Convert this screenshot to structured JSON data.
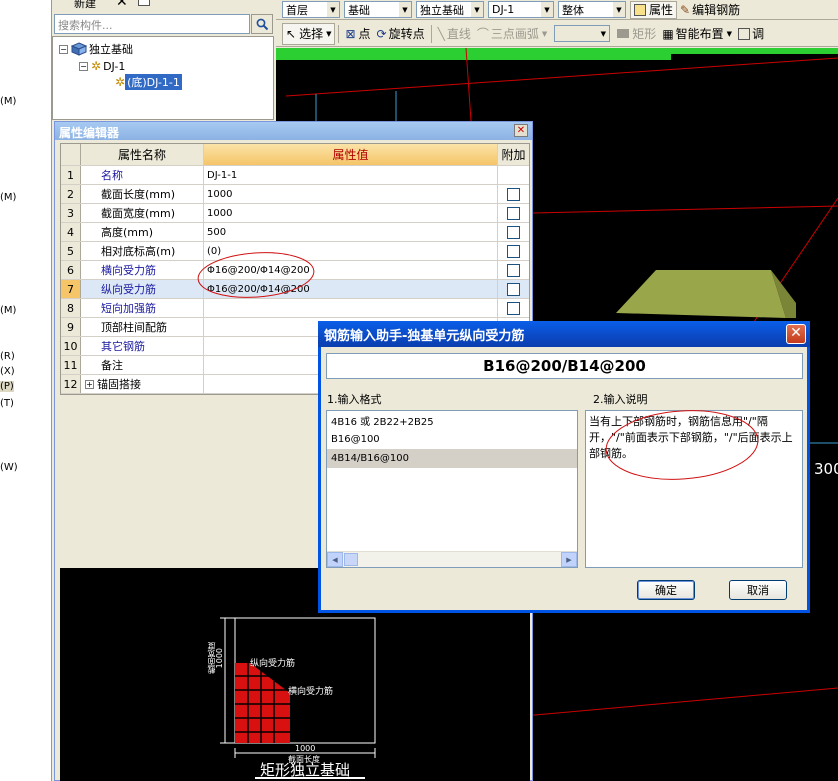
{
  "left_strip": {
    "hotkeys": [
      "(M)",
      "(M)",
      "(M)",
      "(R)",
      "(X)",
      "(P)",
      "(T)",
      "(W)"
    ]
  },
  "top_left_toolbar": {
    "new_label": "新建",
    "delete_icon": "delete-x-icon",
    "copy_icon": "copy-icon"
  },
  "search": {
    "placeholder": "搜索构件..."
  },
  "tree": {
    "root": "独立基础",
    "child": "DJ-1",
    "leaf": "(底)DJ-1-1"
  },
  "top_bar": {
    "combos": [
      "首层",
      "基础",
      "独立基础",
      "DJ-1",
      "整体"
    ],
    "property_label": "属性",
    "edit_rebar_label": "编辑钢筋"
  },
  "toolbar2": {
    "select": "选择",
    "point": "点",
    "rotate_point": "旋转点",
    "line": "直线",
    "arc": "三点画弧",
    "rect": "矩形",
    "smart_layout": "智能布置",
    "adjust": "调"
  },
  "canvas": {
    "label_300": "300"
  },
  "property_editor": {
    "title": "属性编辑器",
    "headers": {
      "num": "",
      "name": "属性名称",
      "value": "属性值",
      "extra": "附加"
    },
    "rows": [
      {
        "num": "1",
        "name": "名称",
        "value": "DJ-1-1",
        "blue": true,
        "checkbox": false
      },
      {
        "num": "2",
        "name": "截面长度(mm)",
        "value": "1000",
        "blue": false,
        "checkbox": true
      },
      {
        "num": "3",
        "name": "截面宽度(mm)",
        "value": "1000",
        "blue": false,
        "checkbox": true
      },
      {
        "num": "4",
        "name": "高度(mm)",
        "value": "500",
        "blue": false,
        "checkbox": true
      },
      {
        "num": "5",
        "name": "相对底标高(m)",
        "value": "(0)",
        "blue": false,
        "checkbox": true
      },
      {
        "num": "6",
        "name": "横向受力筋",
        "value": "Φ16@200/Φ14@200",
        "blue": true,
        "checkbox": true
      },
      {
        "num": "7",
        "name": "纵向受力筋",
        "value": "Φ16@200/Φ14@200",
        "blue": true,
        "checkbox": true
      },
      {
        "num": "8",
        "name": "短向加强筋",
        "value": "",
        "blue": true,
        "checkbox": true
      },
      {
        "num": "9",
        "name": "顶部柱间配筋",
        "value": "",
        "blue": false,
        "checkbox": false
      },
      {
        "num": "10",
        "name": "其它钢筋",
        "value": "",
        "blue": true,
        "checkbox": false
      },
      {
        "num": "11",
        "name": "备注",
        "value": "",
        "blue": false,
        "checkbox": false
      },
      {
        "num": "12",
        "name": "锚固搭接",
        "value": "",
        "blue": false,
        "checkbox": false,
        "expand": "+"
      }
    ]
  },
  "diagram": {
    "width_label": "截面宽度",
    "width_value": "1000",
    "length_value": "1000",
    "length_label": "截面长度",
    "long_rebar": "纵向受力筋",
    "trans_rebar": "横向受力筋",
    "caption": "矩形独立基础"
  },
  "dialog": {
    "title": "钢筋输入助手-独基单元纵向受力筋",
    "input_value": "B16@200/B14@200",
    "format_label": "1.输入格式",
    "desc_label": "2.输入说明",
    "formats": [
      "4B16 或 2B22+2B25",
      "B16@100",
      "4B14/B16@100"
    ],
    "description": "当有上下部钢筋时，钢筋信息用\"/\"隔开，\"/\"前面表示下部钢筋，\"/\"后面表示上部钢筋。",
    "ok": "确定",
    "cancel": "取消"
  },
  "colors": {
    "accent_blue": "#0054e3",
    "canvas_bg": "#000000",
    "canvas_line": "#cc0000",
    "footing": "#9aa64a"
  }
}
